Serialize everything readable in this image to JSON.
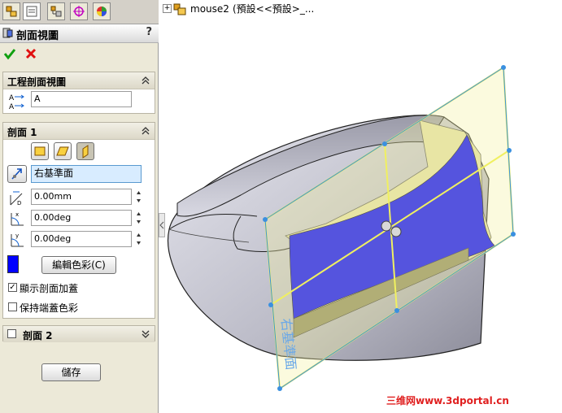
{
  "tree": {
    "expand": "+",
    "part": "mouse2",
    "config": "(預設<<預設>_..."
  },
  "panel": {
    "title": "剖面視圖",
    "help": "?",
    "section_view_group": {
      "label": "工程剖面視圖",
      "name_value": "A"
    },
    "section1": {
      "label": "剖面 1",
      "plane_value": "右基準面",
      "offset_value": "0.00mm",
      "rot_x_value": "0.00deg",
      "rot_y_value": "0.00deg",
      "edit_color_label": "編輯色彩(C)",
      "show_cap_label": "顯示剖面加蓋",
      "keep_cap_color_label": "保持端蓋色彩",
      "show_cap_checked": true,
      "keep_cap_color_checked": false,
      "section_color": "#0000ff"
    },
    "section2": {
      "label": "剖面 2"
    },
    "save_label": "儲存"
  },
  "viewport": {
    "watermark": "三维网www.3dportal.cn",
    "plane_label": "右基準面"
  }
}
